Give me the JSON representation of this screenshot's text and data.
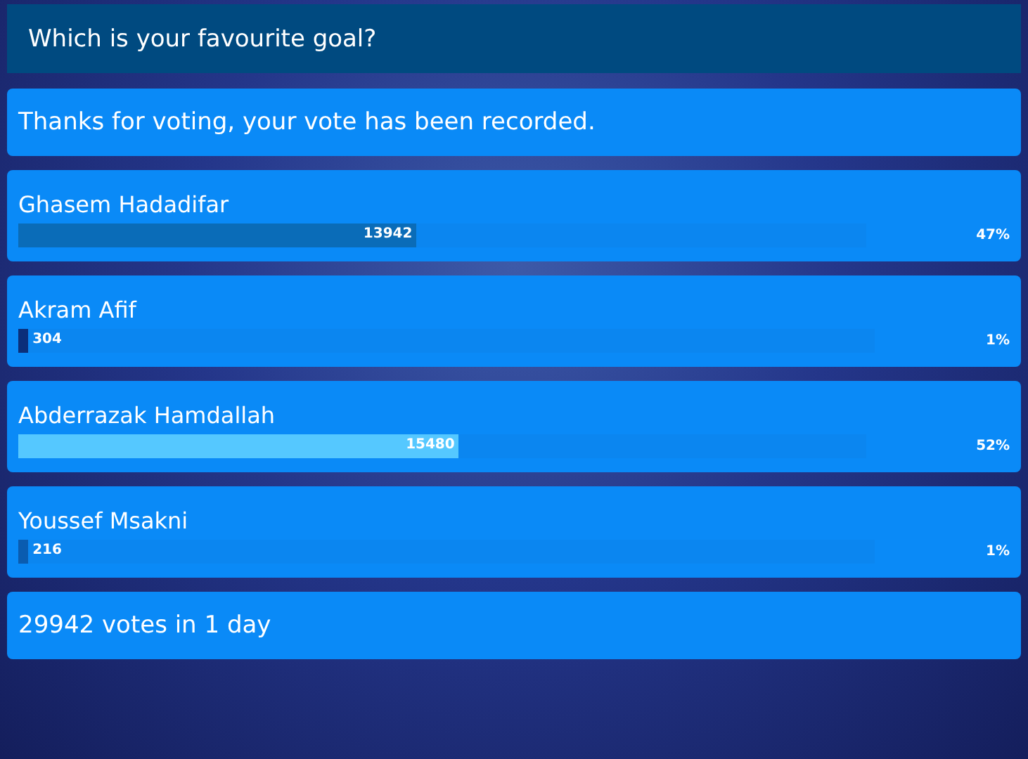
{
  "title": "Which is your favourite goal?",
  "message": "Thanks for voting, your vote has been recorded.",
  "options": [
    {
      "name": "Ghasem Hadadifar",
      "votes": "13942",
      "percent": "47%",
      "level": 0.47,
      "color": "#0a6cb8"
    },
    {
      "name": "Akram Afif",
      "votes": "304",
      "percent": "1%",
      "level": 0.01,
      "color": "#0b2f7a"
    },
    {
      "name": "Abderrazak Hamdallah",
      "votes": "15480",
      "percent": "52%",
      "level": 0.52,
      "color": "#55c8ff"
    },
    {
      "name": "Youssef Msakni",
      "votes": "216",
      "percent": "1%",
      "level": 0.01,
      "color": "#0a5cb0"
    }
  ],
  "summary": "29942 votes in 1 day"
}
